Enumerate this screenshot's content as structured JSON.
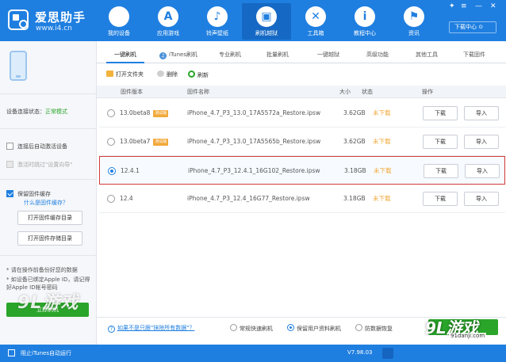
{
  "app": {
    "name": "爱思助手",
    "url": "www.i4.cn",
    "brand_color": "#1f7fe0"
  },
  "nav": [
    {
      "label": "我的设备",
      "icon": "apple-icon"
    },
    {
      "label": "应用游戏",
      "icon": "app-store-icon"
    },
    {
      "label": "铃声壁纸",
      "icon": "ringtone-icon"
    },
    {
      "label": "刷机越狱",
      "icon": "box-icon"
    },
    {
      "label": "工具箱",
      "icon": "tools-icon"
    },
    {
      "label": "教程中心",
      "icon": "info-icon"
    },
    {
      "label": "资讯",
      "icon": "flag-icon"
    }
  ],
  "download_center": "下载中心",
  "left_panel": {
    "connection_label": "设备连接状态：",
    "connection_value": "正常模式",
    "auto_activate": "连接后自动激活设备",
    "skip_setup": "激活时跳过\"设置向导\"",
    "keep_firmware": "保留固件缓存",
    "keep_firmware_link": "什么是固件缓存？",
    "open_cache_btn": "打开固件缓存目录",
    "open_storage_btn": "打开固件存储目录",
    "note_1": "* 请在操作前备份好您的数据",
    "note_2": "* 如设备已绑定Apple ID，请记得好Apple ID帐号密码",
    "flash_btn": "立即刷机"
  },
  "tabs": [
    {
      "label": "一键刷机"
    },
    {
      "label": "iTunes刷机",
      "icon": "itunes-icon"
    },
    {
      "label": "专业刷机"
    },
    {
      "label": "批量刷机"
    },
    {
      "label": "一键越狱"
    },
    {
      "label": "高级功能"
    },
    {
      "label": "其他工具"
    },
    {
      "label": "下载固件"
    }
  ],
  "toolbar": {
    "open_folder": "打开文件夹",
    "delete": "删除",
    "refresh": "刷新"
  },
  "table": {
    "headers": {
      "version": "固件版本",
      "name": "固件名称",
      "size": "大小",
      "status": "状态",
      "action": "操作"
    },
    "rows": [
      {
        "version": "13.0beta8",
        "badge": "测试版",
        "name": "iPhone_4.7_P3_13.0_17A5572a_Restore.ipsw",
        "size": "3.62GB",
        "status": "未下载",
        "download": "下载",
        "import": "导入",
        "selected": false
      },
      {
        "version": "13.0beta7",
        "badge": "测试版",
        "name": "iPhone_4.7_P3_13.0_17A5565b_Restore.ipsw",
        "size": "3.62GB",
        "status": "未下载",
        "download": "下载",
        "import": "导入",
        "selected": false
      },
      {
        "version": "12.4.1",
        "badge": "",
        "name": "iPhone_4.7_P3_12.4.1_16G102_Restore.ipsw",
        "size": "3.18GB",
        "status": "未下载",
        "download": "下载",
        "import": "导入",
        "selected": true
      },
      {
        "version": "12.4",
        "badge": "",
        "name": "iPhone_4.7_P3_12.4_16G77_Restore.ipsw",
        "size": "3.18GB",
        "status": "未下载",
        "download": "下载",
        "import": "导入",
        "selected": false
      }
    ]
  },
  "options": {
    "help": "如果不是只跟\"抹除所有数据\"？",
    "quick": "常规快速刷机",
    "keep_data": "保留用户资料刷机",
    "anti": "防数据恢复"
  },
  "statusbar": {
    "itunes_block": "阻止iTunes自动运行",
    "version": "V7.98.03"
  },
  "watermark": {
    "left": "9L游戏",
    "right": "9L游戏",
    "url": "91danji.com"
  }
}
